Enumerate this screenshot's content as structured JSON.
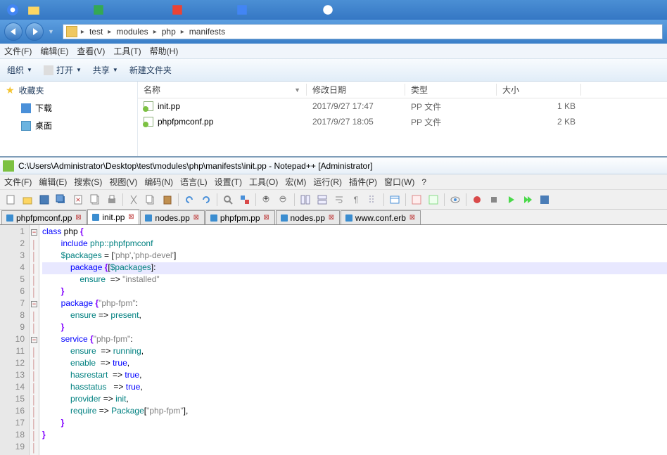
{
  "breadcrumb": [
    "test",
    "modules",
    "php",
    "manifests"
  ],
  "menu1": {
    "file": "文件(F)",
    "edit": "编辑(E)",
    "view": "查看(V)",
    "tools": "工具(T)",
    "help": "帮助(H)"
  },
  "toolbar1": {
    "organize": "组织",
    "open": "打开",
    "share": "共享",
    "newfolder": "新建文件夹"
  },
  "sidebar": {
    "favorites": "收藏夹",
    "downloads": "下载",
    "desktop": "桌面"
  },
  "columns": {
    "name": "名称",
    "date": "修改日期",
    "type": "类型",
    "size": "大小"
  },
  "files": [
    {
      "name": "init.pp",
      "date": "2017/9/27 17:47",
      "type": "PP 文件",
      "size": "1 KB"
    },
    {
      "name": "phpfpmconf.pp",
      "date": "2017/9/27 18:05",
      "type": "PP 文件",
      "size": "2 KB"
    }
  ],
  "npp_title": "C:\\Users\\Administrator\\Desktop\\test\\modules\\php\\manifests\\init.pp - Notepad++ [Administrator]",
  "npp_menu": {
    "file": "文件(F)",
    "edit": "编辑(E)",
    "search": "搜索(S)",
    "view": "视图(V)",
    "encoding": "编码(N)",
    "lang": "语言(L)",
    "settings": "设置(T)",
    "tools": "工具(O)",
    "macro": "宏(M)",
    "run": "运行(R)",
    "plugins": "插件(P)",
    "window": "窗口(W)",
    "help": "?"
  },
  "tabs": [
    "phpfpmconf.pp",
    "init.pp",
    "nodes.pp",
    "phpfpm.pp",
    "nodes.pp",
    "www.conf.erb"
  ],
  "active_tab": 1,
  "code": [
    {
      "n": 1,
      "fold": "box",
      "t": [
        {
          "c": "k-blue",
          "s": "class"
        },
        {
          "c": "",
          "s": " php "
        },
        {
          "c": "k-punct",
          "s": "{"
        }
      ]
    },
    {
      "n": 2,
      "t": [
        {
          "c": "",
          "s": "        "
        },
        {
          "c": "k-blue",
          "s": "include"
        },
        {
          "c": "",
          "s": " "
        },
        {
          "c": "k-teal",
          "s": "php::phpfpmconf"
        }
      ]
    },
    {
      "n": 3,
      "t": [
        {
          "c": "",
          "s": "        "
        },
        {
          "c": "k-teal",
          "s": "$packages"
        },
        {
          "c": "",
          "s": " = ["
        },
        {
          "c": "k-str",
          "s": "'php'"
        },
        {
          "c": "",
          "s": ","
        },
        {
          "c": "k-str",
          "s": "'php-devel'"
        },
        {
          "c": "",
          "s": "]"
        }
      ]
    },
    {
      "n": 4,
      "hl": true,
      "t": [
        {
          "c": "",
          "s": "            "
        },
        {
          "c": "k-blue",
          "s": "package"
        },
        {
          "c": "",
          "s": " "
        },
        {
          "c": "k-punct",
          "s": "{"
        },
        {
          "c": "",
          "s": "["
        },
        {
          "c": "k-teal",
          "s": "$packages"
        },
        {
          "c": "",
          "s": "]:"
        }
      ]
    },
    {
      "n": 5,
      "t": [
        {
          "c": "",
          "s": "                "
        },
        {
          "c": "k-teal",
          "s": "ensure"
        },
        {
          "c": "",
          "s": "  => "
        },
        {
          "c": "k-str",
          "s": "\"installed\""
        }
      ]
    },
    {
      "n": 6,
      "t": [
        {
          "c": "",
          "s": "        "
        },
        {
          "c": "k-punct",
          "s": "}"
        }
      ]
    },
    {
      "n": 7,
      "fold": "box",
      "t": [
        {
          "c": "",
          "s": "        "
        },
        {
          "c": "k-blue",
          "s": "package"
        },
        {
          "c": "",
          "s": " "
        },
        {
          "c": "k-punct",
          "s": "{"
        },
        {
          "c": "k-str",
          "s": "\"php-fpm\""
        },
        {
          "c": "",
          "s": ":"
        }
      ]
    },
    {
      "n": 8,
      "t": [
        {
          "c": "",
          "s": "            "
        },
        {
          "c": "k-teal",
          "s": "ensure"
        },
        {
          "c": "",
          "s": " => "
        },
        {
          "c": "k-teal",
          "s": "present"
        },
        {
          "c": "",
          "s": ","
        }
      ]
    },
    {
      "n": 9,
      "t": [
        {
          "c": "",
          "s": "        "
        },
        {
          "c": "k-punct",
          "s": "}"
        }
      ]
    },
    {
      "n": 10,
      "fold": "box",
      "t": [
        {
          "c": "",
          "s": "        "
        },
        {
          "c": "k-blue",
          "s": "service"
        },
        {
          "c": "",
          "s": " "
        },
        {
          "c": "k-punct",
          "s": "{"
        },
        {
          "c": "k-str",
          "s": "\"php-fpm\""
        },
        {
          "c": "",
          "s": ":"
        }
      ]
    },
    {
      "n": 11,
      "t": [
        {
          "c": "",
          "s": "            "
        },
        {
          "c": "k-teal",
          "s": "ensure"
        },
        {
          "c": "",
          "s": "  => "
        },
        {
          "c": "k-teal",
          "s": "running"
        },
        {
          "c": "",
          "s": ","
        }
      ]
    },
    {
      "n": 12,
      "t": [
        {
          "c": "",
          "s": "            "
        },
        {
          "c": "k-teal",
          "s": "enable"
        },
        {
          "c": "",
          "s": "  => "
        },
        {
          "c": "k-blue",
          "s": "true"
        },
        {
          "c": "",
          "s": ","
        }
      ]
    },
    {
      "n": 13,
      "t": [
        {
          "c": "",
          "s": "            "
        },
        {
          "c": "k-teal",
          "s": "hasrestart"
        },
        {
          "c": "",
          "s": "  => "
        },
        {
          "c": "k-blue",
          "s": "true"
        },
        {
          "c": "",
          "s": ","
        }
      ]
    },
    {
      "n": 14,
      "t": [
        {
          "c": "",
          "s": "            "
        },
        {
          "c": "k-teal",
          "s": "hasstatus"
        },
        {
          "c": "",
          "s": "   => "
        },
        {
          "c": "k-blue",
          "s": "true"
        },
        {
          "c": "",
          "s": ","
        }
      ]
    },
    {
      "n": 15,
      "t": [
        {
          "c": "",
          "s": "            "
        },
        {
          "c": "k-teal",
          "s": "provider"
        },
        {
          "c": "",
          "s": " => "
        },
        {
          "c": "k-teal",
          "s": "init"
        },
        {
          "c": "",
          "s": ","
        }
      ]
    },
    {
      "n": 16,
      "t": [
        {
          "c": "",
          "s": "            "
        },
        {
          "c": "k-teal",
          "s": "require"
        },
        {
          "c": "",
          "s": " => "
        },
        {
          "c": "k-teal",
          "s": "Package"
        },
        {
          "c": "",
          "s": "["
        },
        {
          "c": "k-str",
          "s": "\"php-fpm\""
        },
        {
          "c": "",
          "s": "],"
        }
      ]
    },
    {
      "n": 17,
      "t": [
        {
          "c": "",
          "s": "        "
        },
        {
          "c": "k-punct",
          "s": "}"
        }
      ]
    },
    {
      "n": 18,
      "t": [
        {
          "c": "k-punct",
          "s": "}"
        }
      ]
    },
    {
      "n": 19,
      "t": []
    }
  ]
}
